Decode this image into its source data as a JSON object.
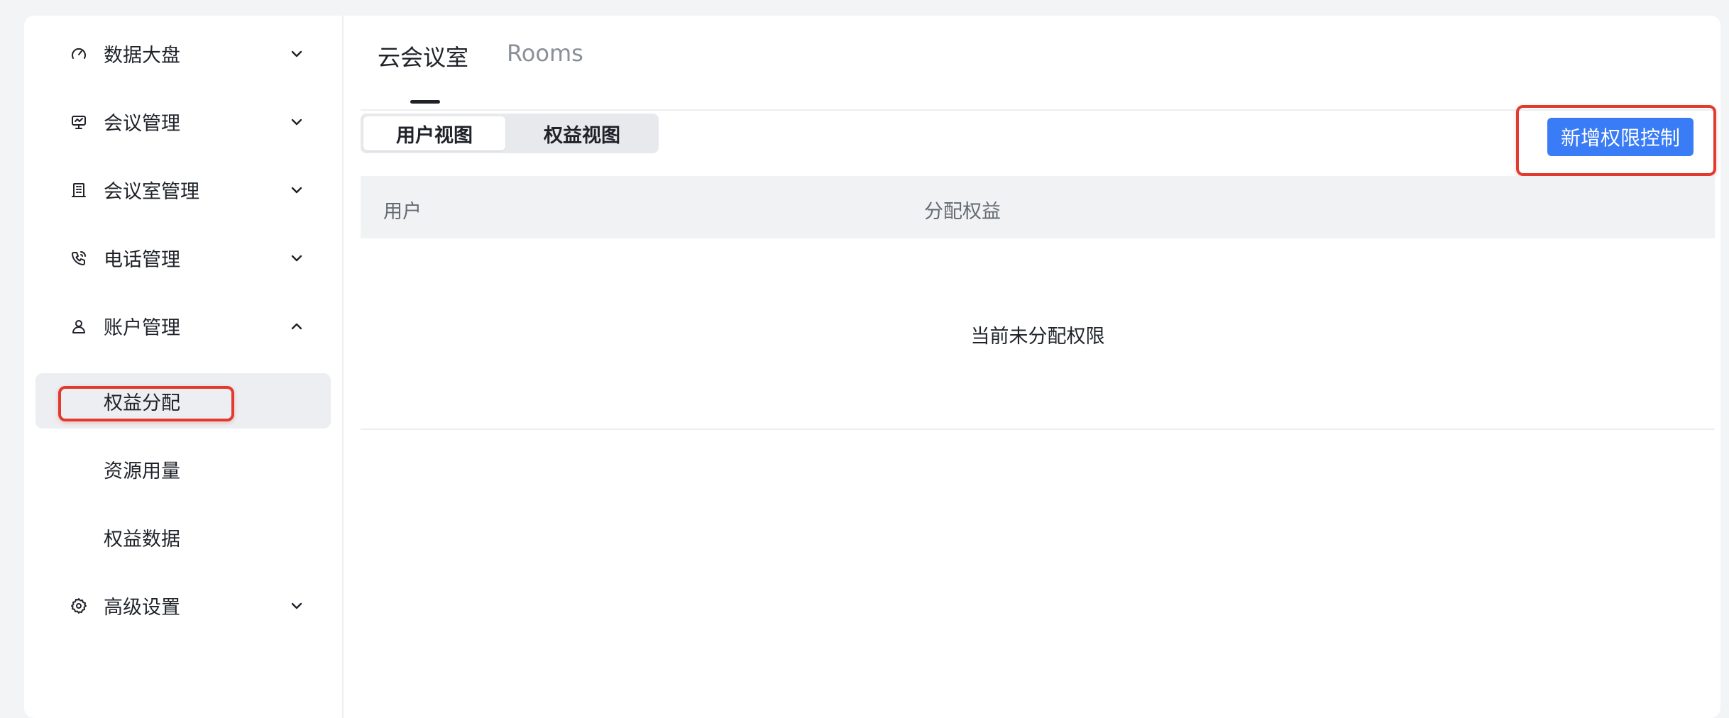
{
  "sidebar": {
    "items": [
      {
        "label": "数据大盘",
        "icon": "dashboard-gauge-icon",
        "expanded": false
      },
      {
        "label": "会议管理",
        "icon": "monitor-icon",
        "expanded": false
      },
      {
        "label": "会议室管理",
        "icon": "building-icon",
        "expanded": false
      },
      {
        "label": "电话管理",
        "icon": "phone-icon",
        "expanded": false
      },
      {
        "label": "账户管理",
        "icon": "user-icon",
        "expanded": true
      },
      {
        "label": "高级设置",
        "icon": "gear-icon",
        "expanded": false
      }
    ],
    "sub_items": [
      {
        "label": "权益分配",
        "active": true
      },
      {
        "label": "资源用量",
        "active": false
      },
      {
        "label": "权益数据",
        "active": false
      }
    ]
  },
  "tabs": [
    {
      "label": "云会议室",
      "active": true
    },
    {
      "label": "Rooms",
      "active": false
    }
  ],
  "view_switch": {
    "options": [
      "用户视图",
      "权益视图"
    ],
    "selected": "用户视图"
  },
  "actions": {
    "add_permission_label": "新增权限控制"
  },
  "table": {
    "columns": [
      "用户",
      "分配权益"
    ],
    "empty_text": "当前未分配权限"
  },
  "colors": {
    "primary": "#3a7bf6",
    "annotation": "#e23a2e",
    "text": "#1f2329",
    "muted": "#8a8f99"
  }
}
